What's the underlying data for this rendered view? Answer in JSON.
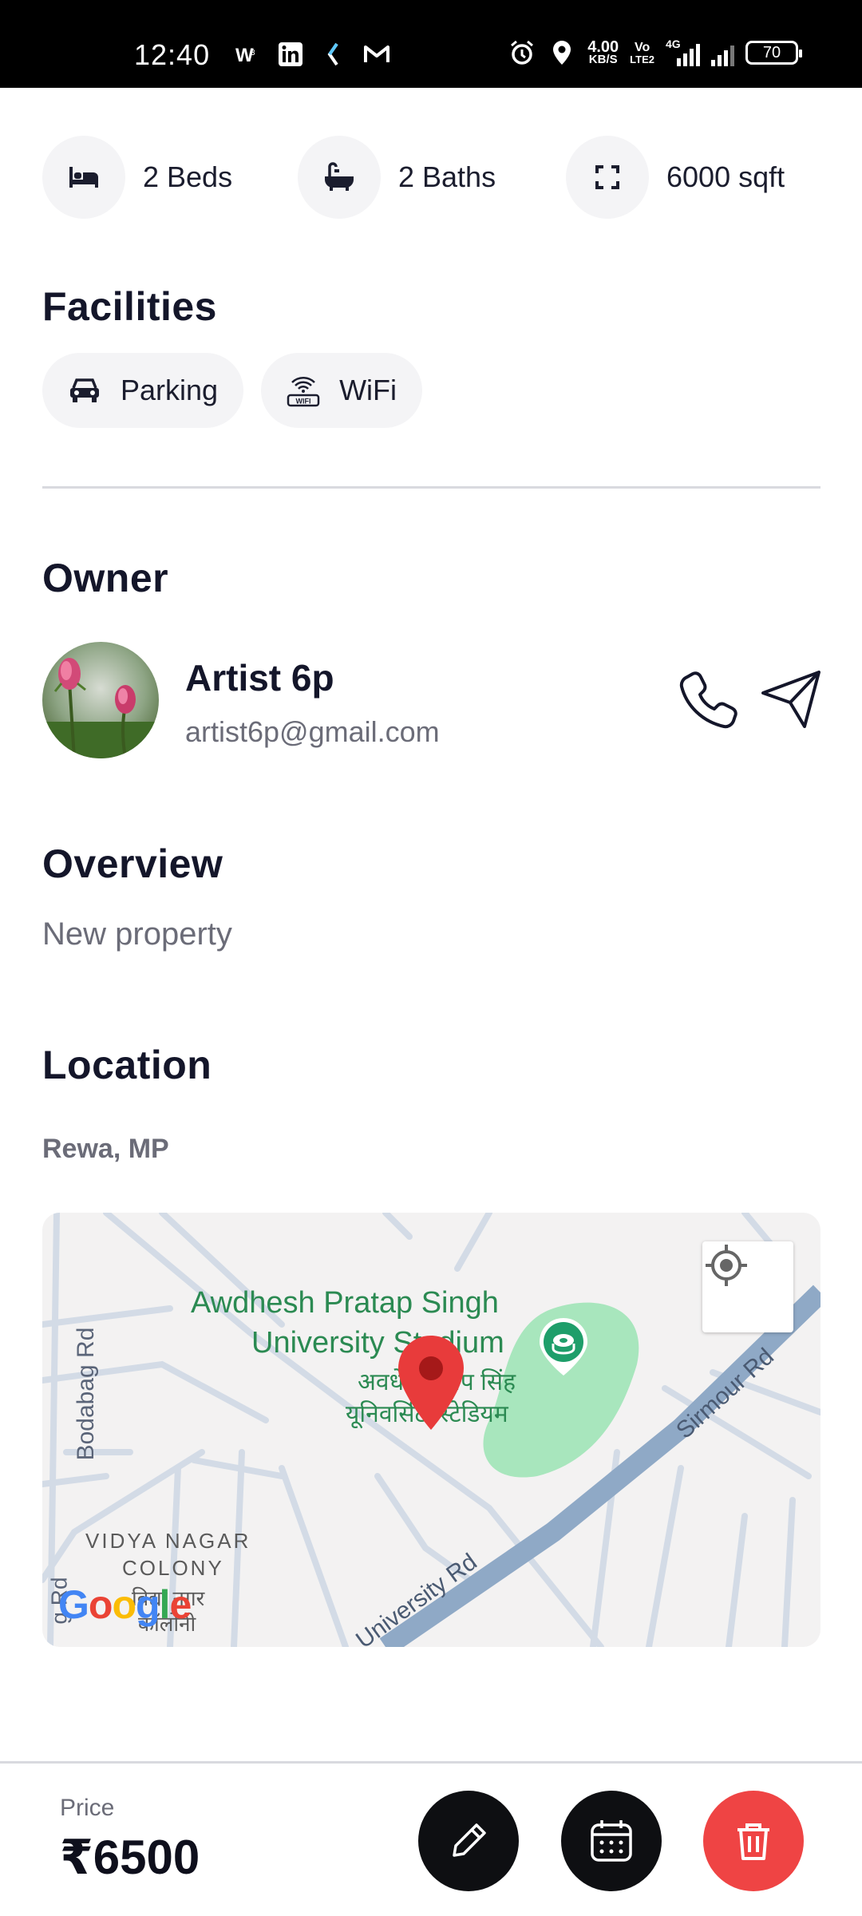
{
  "status_bar": {
    "time": "12:40",
    "net_speed": "4.00",
    "net_unit": "KB/S",
    "volte_top": "Vo",
    "volte_bottom": "LTE2",
    "network": "4G",
    "battery": "70"
  },
  "specs": [
    {
      "icon": "bed-icon",
      "label": "2 Beds"
    },
    {
      "icon": "bathtub-icon",
      "label": "2 Baths"
    },
    {
      "icon": "expand-icon",
      "label": "6000 sqft"
    }
  ],
  "facilities": {
    "title": "Facilities",
    "items": [
      {
        "icon": "car-icon",
        "label": "Parking"
      },
      {
        "icon": "wifi-icon",
        "label": "WiFi"
      }
    ]
  },
  "owner": {
    "title": "Owner",
    "name": "Artist 6p",
    "email": "artist6p@gmail.com"
  },
  "overview": {
    "title": "Overview",
    "text": "New property"
  },
  "location": {
    "title": "Location",
    "text": "Rewa, MP",
    "map": {
      "stadium_en_1": "Awdhesh Pratap Singh",
      "stadium_en_2": "University Stadium",
      "stadium_hi_1": "अवधेश प्रताप सिंह",
      "stadium_hi_2": "यूनिवर्सिटी स्टेडियम",
      "road_bodabag": "Bodabag Rd",
      "road_sirmour": "Sirmour Rd",
      "road_university": "University Rd",
      "road_left": "g Rd",
      "colony_1": "VIDYA NAGAR",
      "colony_2": "COLONY",
      "colony_hi_1": "विद्या नगर",
      "colony_hi_2": "कॉलोनी",
      "google": "Google"
    }
  },
  "price": {
    "label": "Price",
    "value": "₹6500"
  },
  "colors": {
    "accent_red": "#ef4444",
    "dark": "#0e0f12",
    "park_green": "#a8e6bd",
    "road_blue": "#8fa9c6"
  }
}
